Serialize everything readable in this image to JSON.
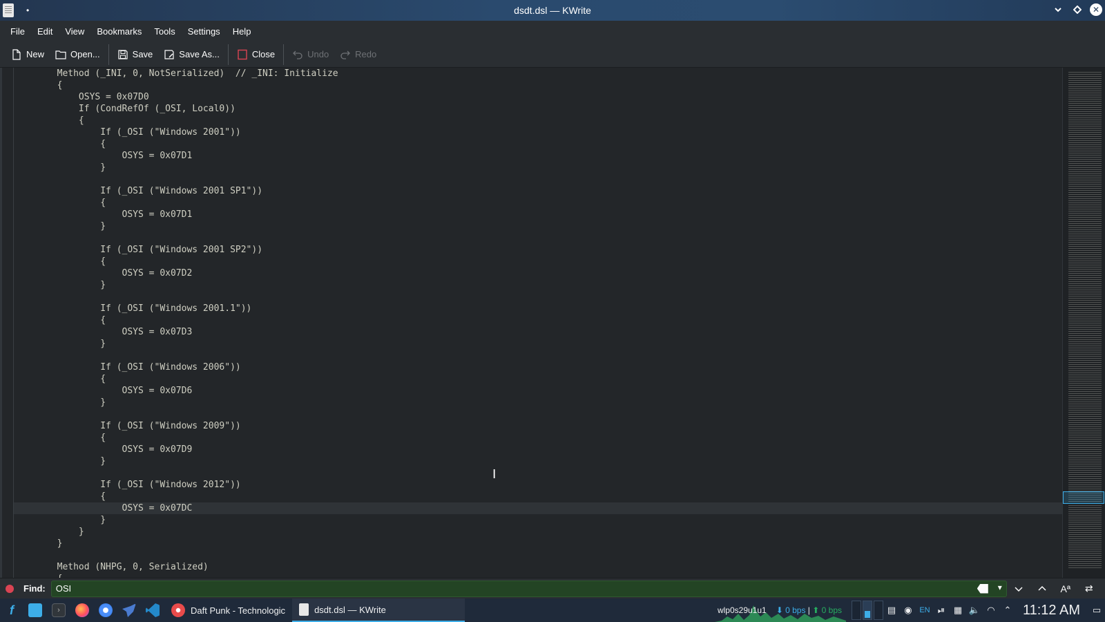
{
  "window": {
    "title": "dsdt.dsl — KWrite",
    "pin_glyph": "•"
  },
  "menubar": {
    "items": [
      "File",
      "Edit",
      "View",
      "Bookmarks",
      "Tools",
      "Settings",
      "Help"
    ]
  },
  "toolbar": {
    "new_label": "New",
    "open_label": "Open...",
    "save_label": "Save",
    "save_as_label": "Save As...",
    "close_label": "Close",
    "undo_label": "Undo",
    "redo_label": "Redo"
  },
  "editor": {
    "current_line_index": 37,
    "lines": [
      "        Method (_INI, 0, NotSerialized)  // _INI: Initialize",
      "        {",
      "            OSYS = 0x07D0",
      "            If (CondRefOf (_OSI, Local0))",
      "            {",
      "                If (_OSI (\"Windows 2001\"))",
      "                {",
      "                    OSYS = 0x07D1",
      "                }",
      "",
      "                If (_OSI (\"Windows 2001 SP1\"))",
      "                {",
      "                    OSYS = 0x07D1",
      "                }",
      "",
      "                If (_OSI (\"Windows 2001 SP2\"))",
      "                {",
      "                    OSYS = 0x07D2",
      "                }",
      "",
      "                If (_OSI (\"Windows 2001.1\"))",
      "                {",
      "                    OSYS = 0x07D3",
      "                }",
      "",
      "                If (_OSI (\"Windows 2006\"))",
      "                {",
      "                    OSYS = 0x07D6",
      "                }",
      "",
      "                If (_OSI (\"Windows 2009\"))",
      "                {",
      "                    OSYS = 0x07D9",
      "                }",
      "",
      "                If (_OSI (\"Windows 2012\"))",
      "                {",
      "                    OSYS = 0x07DC",
      "                }",
      "            }",
      "        }",
      "",
      "        Method (NHPG, 0, Serialized)",
      "        {"
    ]
  },
  "findbar": {
    "label": "Find:",
    "value": "OSI"
  },
  "taskbar": {
    "windows": [
      {
        "label": "Daft Punk - Technologic",
        "active": false
      },
      {
        "label": "dsdt.dsl — KWrite",
        "active": true
      }
    ],
    "network": {
      "interface": "wlp0s29u1u1",
      "down": "⬇ 0 bps",
      "sep": " | ",
      "up": "⬆ 0 bps"
    },
    "keyboard_layout": "EN",
    "clock": "11:12 AM"
  },
  "colors": {
    "accent": "#3daee9",
    "editor_bg": "#232629",
    "find_match_bg": "#234424",
    "close_red": "#da4453"
  }
}
